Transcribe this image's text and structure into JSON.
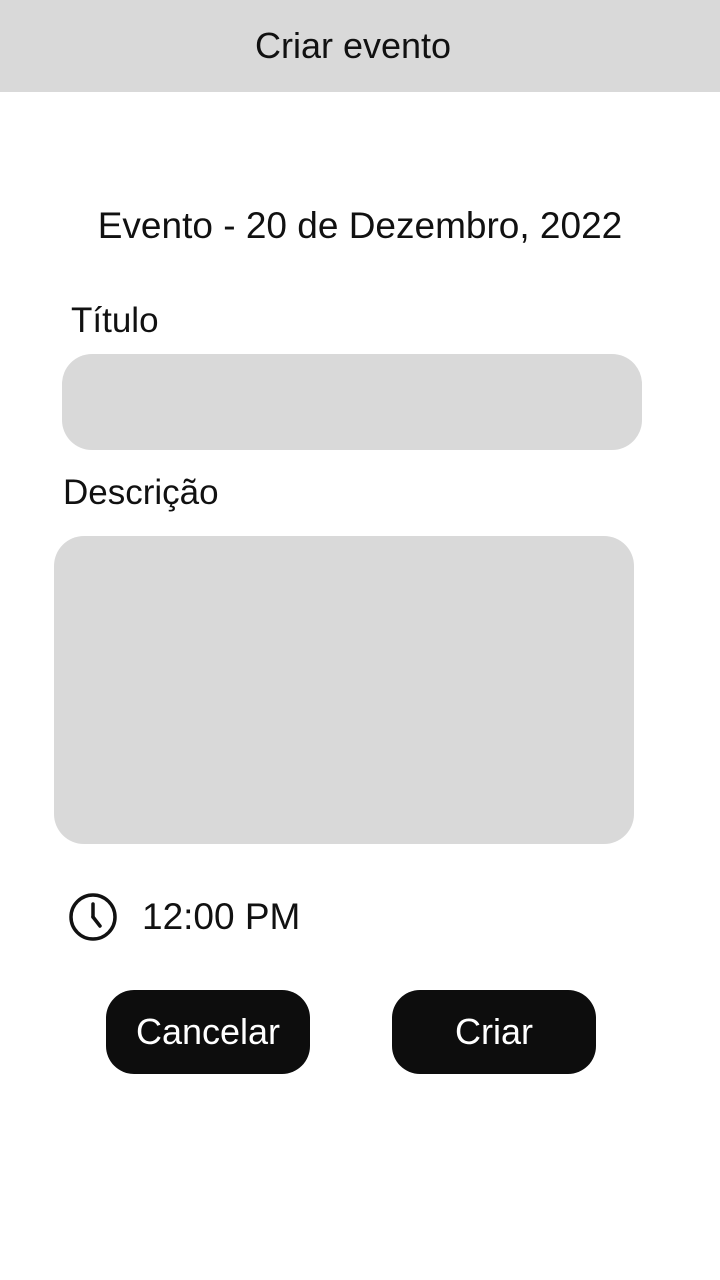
{
  "header": {
    "title": "Criar evento"
  },
  "event": {
    "heading": "Evento - 20 de Dezembro, 2022"
  },
  "form": {
    "title_label": "Título",
    "title_value": "",
    "description_label": "Descrição",
    "description_value": ""
  },
  "time": {
    "icon": "clock-icon",
    "value": "12:00 PM"
  },
  "actions": {
    "cancel_label": "Cancelar",
    "create_label": "Criar"
  },
  "colors": {
    "header_bg": "#d9d9d9",
    "field_bg": "#d9d9d9",
    "button_bg": "#0d0d0d",
    "button_text": "#ffffff"
  }
}
